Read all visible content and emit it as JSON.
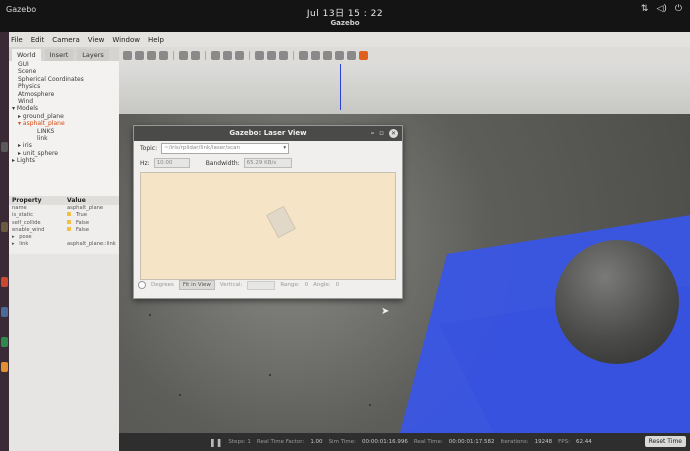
{
  "system": {
    "app_name": "Gazebo",
    "clock": "Jul 13日 15 : 22",
    "window_title": "Gazebo"
  },
  "menu": [
    "File",
    "Edit",
    "Camera",
    "View",
    "Window",
    "Help"
  ],
  "panel_tabs": [
    "World",
    "Insert",
    "Layers"
  ],
  "tree": {
    "gui": "GUI",
    "scene": "Scene",
    "spherical": "Spherical Coordinates",
    "physics": "Physics",
    "atmosphere": "Atmosphere",
    "wind": "Wind",
    "models": "Models",
    "ground_plane": "ground_plane",
    "asphalt_plane": "asphalt_plane",
    "links": "LINKS",
    "link": "link",
    "iris": "iris",
    "unit_sphere": "unit_sphere",
    "lights": "Lights"
  },
  "properties": {
    "header_property": "Property",
    "header_value": "Value",
    "rows": [
      {
        "name": "name",
        "value": "asphalt_plane"
      },
      {
        "name": "is_static",
        "value": "True"
      },
      {
        "name": "self_collide",
        "value": "False"
      },
      {
        "name": "enable_wind",
        "value": "False"
      }
    ],
    "pose_label": "pose",
    "link_label": "link",
    "link_value": "asphalt_plane::link"
  },
  "laser_dialog": {
    "title": "Gazebo: Laser View",
    "topic_label": "Topic:",
    "topic_value": "~/iris/rplidar/link/laser/scan",
    "hz_label": "Hz:",
    "hz_value": "10.00",
    "bandwidth_label": "Bandwidth:",
    "bandwidth_value": "65.29 KB/s",
    "degrees_label": "Degrees",
    "fit_label": "Fit in View",
    "vertical_label": "Vertical:",
    "range_label": "Range:",
    "range_value": "0",
    "angle_label": "Angle:",
    "angle_value": "0"
  },
  "statusbar": {
    "steps": "Steps: 1",
    "rtf_label": "Real Time Factor:",
    "rtf_value": "1.00",
    "sim_time_label": "Sim Time:",
    "sim_time_value": "00:00:01:16.996",
    "real_time_label": "Real Time:",
    "real_time_value": "00:00:01:17.582",
    "iterations_label": "Iterations:",
    "iterations_value": "19248",
    "fps_label": "FPS:",
    "fps_value": "62.44",
    "reset_label": "Reset Time"
  },
  "colors": {
    "laser": "#3a56e6",
    "selected": "#d84810"
  }
}
